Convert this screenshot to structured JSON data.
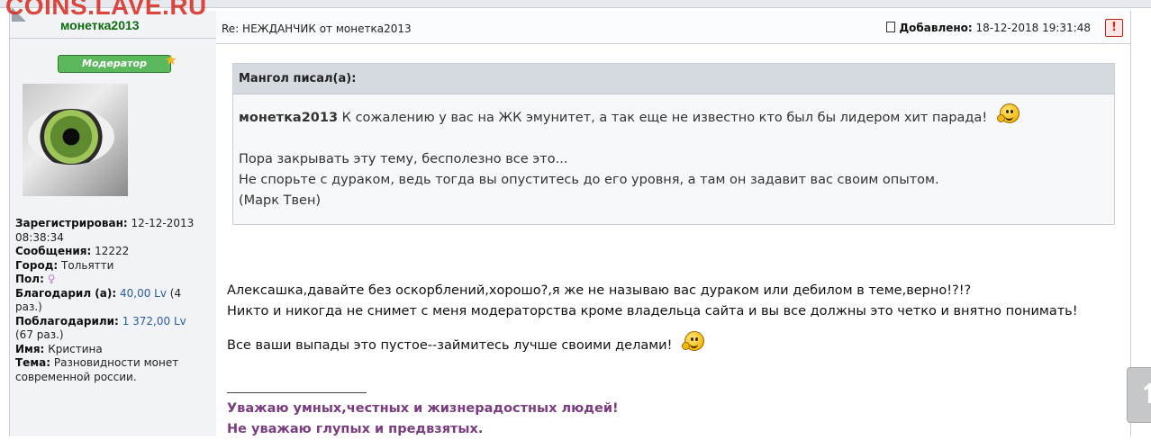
{
  "watermark": "COINS.LAVE.RU",
  "author": {
    "name": "монетка2013",
    "rank_badge": "Модератор",
    "profile": [
      {
        "label": "Зарегистрирован:",
        "value": "12-12-2013 08:38:34"
      },
      {
        "label": "Сообщения:",
        "value": "12222"
      },
      {
        "label": "Город:",
        "value": "Тольятти"
      },
      {
        "label": "Пол:",
        "value": ""
      },
      {
        "label": "Благодарил (а):",
        "value": "40,00 Lv",
        "suffix": "(4 раз.)"
      },
      {
        "label": "Поблагодарили:",
        "value": "1 372,00 Lv",
        "suffix": "(67 раз.)"
      },
      {
        "label": "Имя:",
        "value": "Кристина"
      },
      {
        "label": "Тема:",
        "value": "Разновидности монет современной россии."
      }
    ]
  },
  "post": {
    "subject": "Re: НЕЖДАНЧИК от монетка2013",
    "added_label": "Добавлено:",
    "added_date": "18-12-2018 19:31:48",
    "report_icon": "!",
    "quote": {
      "header": "Мангол писал(а):",
      "quoted_name": "монетка2013",
      "line1": "К сожалению у вас на ЖК эмунитет, а так еще не известно кто был бы лидером хит парада!",
      "line2": "Пора закрывать эту тему, бесполезно все это...",
      "line3": "Не спорьте с дураком, ведь тогда вы опуститесь до его уровня, а там он задавит вас своим опытом.",
      "line4": "(Марк Твен)"
    },
    "message": {
      "line1": "Алексашка,давайте без оскорблений,хорошо?,я же не называю вас дураком или дебилом в теме,верно!?!?",
      "line2": "Никто и никогда не снимет с меня модераторства кроме владельца сайта и вы все должны это четко и внятно понимать!",
      "line3": "Все ваши выпады это пустое--займитесь лучше своими делами!"
    },
    "signature": {
      "line1": "Уважаю умных,честных и жизнерадостных людей!",
      "line2": "Не уважаю глупых и предвзятых."
    }
  },
  "scroll_top_glyph": "↑",
  "icons": [
    "document-icon",
    "report-icon",
    "star-icon",
    "female-icon",
    "smiley-icon",
    "avatar-image"
  ]
}
